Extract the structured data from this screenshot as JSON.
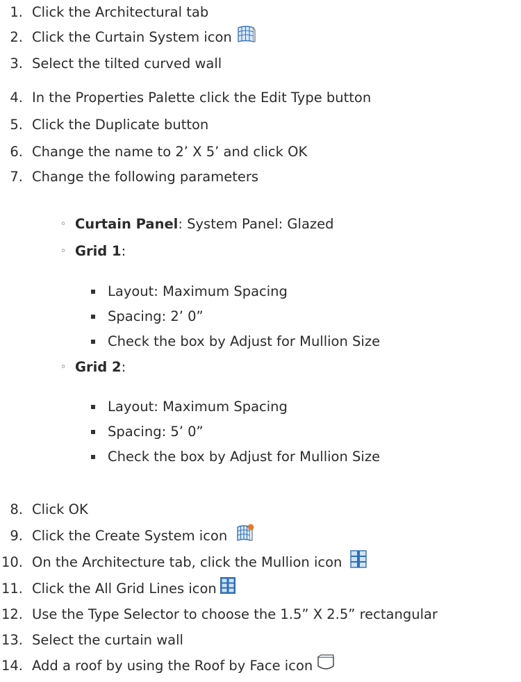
{
  "steps": [
    {
      "num": "1.",
      "text": "Click the Architectural tab"
    },
    {
      "num": "2.",
      "text": "Click the Curtain System icon",
      "icon": "curtain-system-icon"
    },
    {
      "num": "3.",
      "text": "Select the tilted curved wall"
    },
    {
      "num": "4.",
      "text": "In the Properties Palette click the Edit Type button"
    },
    {
      "num": "5.",
      "text": "Click the Duplicate button"
    },
    {
      "num": "6.",
      "text": "Change the name to 2’ X 5’ and click OK"
    },
    {
      "num": "7.",
      "text": "Change the following parameters"
    },
    {
      "num": "8.",
      "text": "Click OK"
    },
    {
      "num": "9.",
      "text": "Click the Create System icon",
      "icon": "create-system-icon"
    },
    {
      "num": "10.",
      "text": "On the Architecture tab, click the Mullion icon",
      "icon": "mullion-icon"
    },
    {
      "num": "11.",
      "text": "Click the All Grid Lines icon",
      "icon": "all-grid-lines-icon"
    },
    {
      "num": "12.",
      "text": "Use the Type Selector to choose the 1.5” X 2.5” rectangular"
    },
    {
      "num": "13.",
      "text": "Select the curtain wall"
    },
    {
      "num": "14.",
      "text": "Add a roof by using the Roof by Face icon",
      "icon": "roof-by-face-icon"
    }
  ],
  "parameters": {
    "curtain_panel": {
      "label": "Curtain Panel",
      "value": ": System Panel: Glazed"
    },
    "grid1": {
      "label": "Grid 1",
      "suffix": ":",
      "items": [
        "Layout: Maximum Spacing",
        "Spacing: 2’ 0”",
        "Check the box by Adjust for Mullion Size"
      ]
    },
    "grid2": {
      "label": "Grid 2",
      "suffix": ":",
      "items": [
        "Layout: Maximum Spacing",
        "Spacing: 5’ 0”",
        "Check the box by Adjust for Mullion Size"
      ]
    }
  },
  "colors": {
    "text": "#2b2b2b",
    "icon_blue": "#4a86c8",
    "icon_light_blue": "#cfe3f7"
  }
}
